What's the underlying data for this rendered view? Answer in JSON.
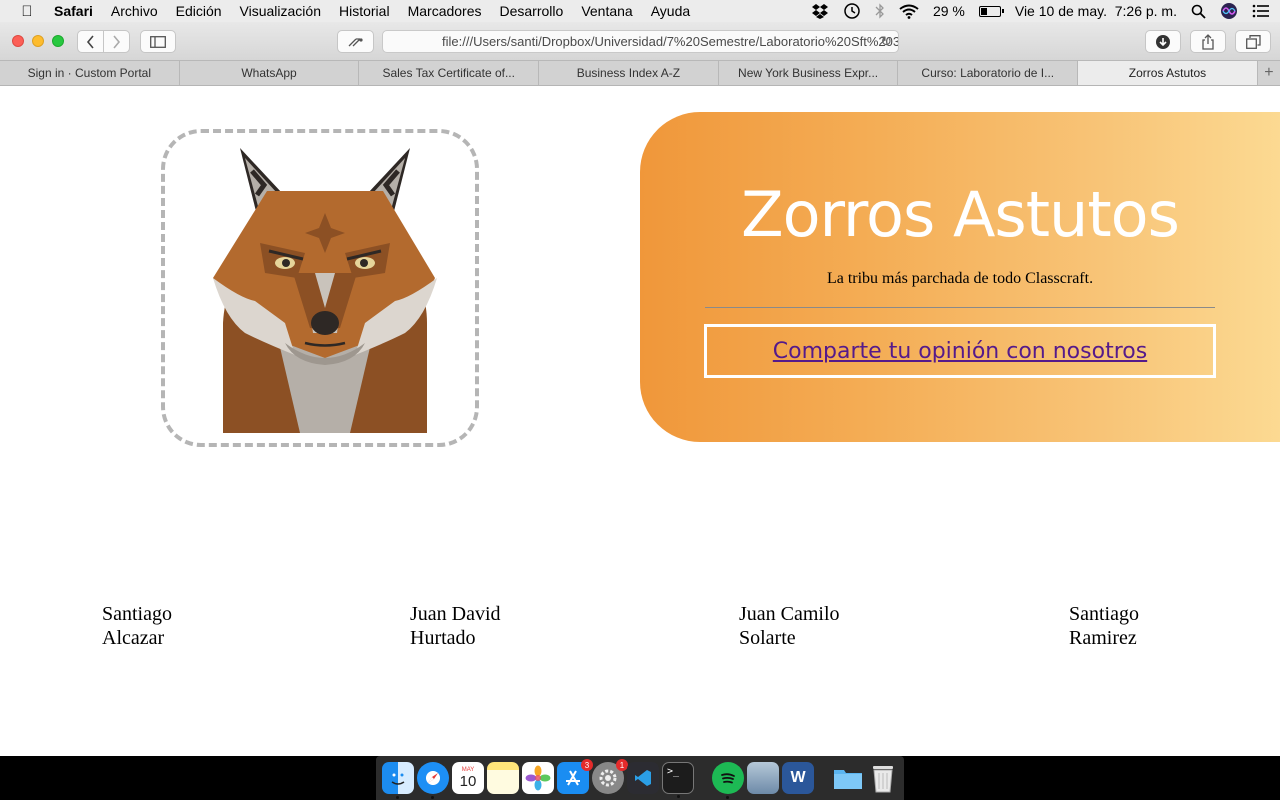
{
  "menubar": {
    "app_name": "Safari",
    "items": [
      "Archivo",
      "Edición",
      "Visualización",
      "Historial",
      "Marcadores",
      "Desarrollo",
      "Ventana",
      "Ayuda"
    ],
    "battery": "29 %",
    "battery_level": 0.29,
    "datetime": "Vie 10 de may.  7:26 p. m."
  },
  "browser": {
    "url": "file:///Users/santi/Dropbox/Universidad/7%20Semestre/Laboratorio%20Sft%203",
    "tabs": [
      {
        "label": "Sign in · Custom Portal"
      },
      {
        "label": "WhatsApp"
      },
      {
        "label": "Sales Tax Certificate of..."
      },
      {
        "label": "Business Index A-Z"
      },
      {
        "label": "New York Business Expr..."
      },
      {
        "label": "Curso: Laboratorio de I..."
      },
      {
        "label": "Zorros Astutos",
        "active": true
      }
    ]
  },
  "page": {
    "title": "Zorros Astutos",
    "tagline": "La tribu más parchada de todo Classcraft.",
    "cta_label": "Comparte tu opinión con nosotros",
    "members": [
      {
        "first": "Santiago",
        "last": "Alcazar"
      },
      {
        "first": "Juan David",
        "last": "Hurtado"
      },
      {
        "first": "Juan Camilo",
        "last": "Solarte"
      },
      {
        "first": "Santiago",
        "last": "Ramirez"
      }
    ]
  },
  "dock": {
    "apps": [
      "finder-icon",
      "safari-icon",
      "calendar-icon",
      "notes-icon",
      "photos-icon",
      "app-store-icon",
      "system-preferences-icon",
      "vscode-icon",
      "terminal-icon",
      "spotify-icon",
      "preview-icon",
      "word-icon",
      "downloads-folder-icon",
      "trash-icon"
    ],
    "calendar_day": "10",
    "app_store_badge": "3",
    "system_preferences_badge": "1"
  },
  "colors": {
    "hero_gradient_start": "#f0973a",
    "hero_gradient_end": "#fcdc95",
    "link": "#551a8b"
  }
}
